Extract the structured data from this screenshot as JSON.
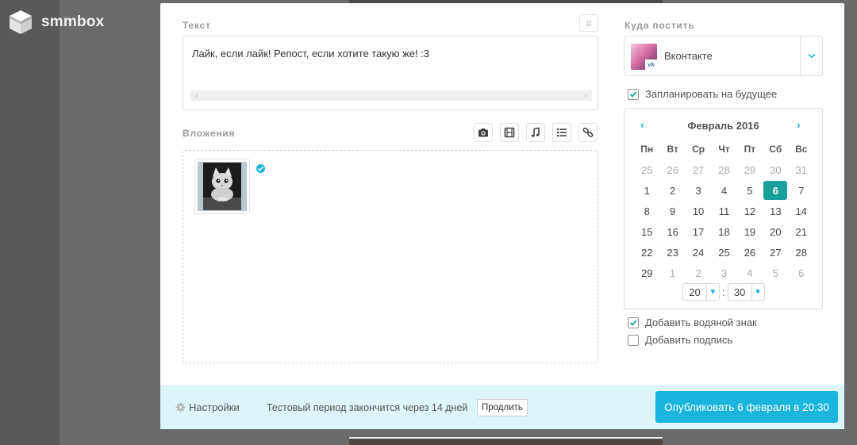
{
  "app": {
    "logo_text": "smmbox"
  },
  "text_section": {
    "label": "Текст",
    "hash_button": "#",
    "content": "Лайк, если лайк! Репост, если хотите такую же! :3"
  },
  "attachments": {
    "label": "Вложения",
    "tools": [
      "camera-icon",
      "video-icon",
      "music-icon",
      "list-icon",
      "link-icon"
    ]
  },
  "destination": {
    "label": "Куда постить",
    "network": "Вконтакте",
    "network_badge": "vk"
  },
  "schedule": {
    "label": "Запланировать на будущее",
    "checked": true
  },
  "calendar": {
    "month": "Февраль 2016",
    "prev": "‹",
    "next": "›",
    "weekdays": [
      "Пн",
      "Вт",
      "Ср",
      "Чт",
      "Пт",
      "Сб",
      "Вс"
    ],
    "weeks": [
      [
        {
          "d": "25",
          "o": true
        },
        {
          "d": "26",
          "o": true
        },
        {
          "d": "27",
          "o": true
        },
        {
          "d": "28",
          "o": true
        },
        {
          "d": "29",
          "o": true
        },
        {
          "d": "30",
          "o": true
        },
        {
          "d": "31",
          "o": true
        }
      ],
      [
        {
          "d": "1"
        },
        {
          "d": "2"
        },
        {
          "d": "3"
        },
        {
          "d": "4"
        },
        {
          "d": "5"
        },
        {
          "d": "6",
          "s": true
        },
        {
          "d": "7"
        }
      ],
      [
        {
          "d": "8"
        },
        {
          "d": "9"
        },
        {
          "d": "10"
        },
        {
          "d": "11"
        },
        {
          "d": "12"
        },
        {
          "d": "13"
        },
        {
          "d": "14"
        }
      ],
      [
        {
          "d": "15"
        },
        {
          "d": "16"
        },
        {
          "d": "17"
        },
        {
          "d": "18"
        },
        {
          "d": "19"
        },
        {
          "d": "20"
        },
        {
          "d": "21"
        }
      ],
      [
        {
          "d": "22"
        },
        {
          "d": "23"
        },
        {
          "d": "24"
        },
        {
          "d": "25"
        },
        {
          "d": "26"
        },
        {
          "d": "27"
        },
        {
          "d": "28"
        }
      ],
      [
        {
          "d": "29"
        },
        {
          "d": "1",
          "o": true
        },
        {
          "d": "2",
          "o": true
        },
        {
          "d": "3",
          "o": true
        },
        {
          "d": "4",
          "o": true
        },
        {
          "d": "5",
          "o": true
        },
        {
          "d": "6",
          "o": true
        }
      ]
    ],
    "hour": "20",
    "minute": "30",
    "separator": ":"
  },
  "options": {
    "watermark": {
      "label": "Добавить водяной знак",
      "checked": true
    },
    "signature": {
      "label": "Добавить подпись",
      "checked": false
    }
  },
  "footer": {
    "settings": "Настройки",
    "trial_text": "Тестовый период закончится через 14 дней",
    "extend": "Продлить",
    "publish": "Опубликовать 6 февраля в 20:30"
  },
  "colors": {
    "accent": "#1ab4dd",
    "selected_day": "#1aa09a",
    "footer_bg": "#dbf5fa"
  }
}
